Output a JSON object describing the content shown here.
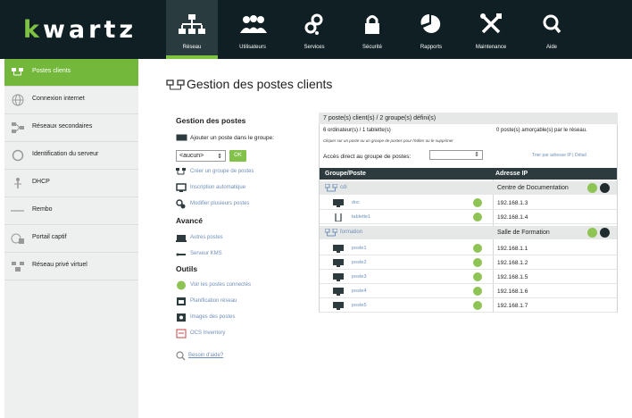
{
  "app": {
    "logo": "kwartz",
    "logo_first": "k",
    "logo_rest": "wartz"
  },
  "nav": [
    {
      "label": "Réseau",
      "icon": "network-icon",
      "active": true
    },
    {
      "label": "Utilisateurs",
      "icon": "users-icon"
    },
    {
      "label": "Services",
      "icon": "gears-icon"
    },
    {
      "label": "Sécurité",
      "icon": "lock-icon"
    },
    {
      "label": "Rapports",
      "icon": "pie-chart-icon"
    },
    {
      "label": "Maintenance",
      "icon": "tools-icon"
    },
    {
      "label": "Aide",
      "icon": "search-icon"
    }
  ],
  "sidebar": {
    "items": [
      {
        "label": "Postes clients",
        "icon": "clients-icon",
        "active": true
      },
      {
        "label": "Connexion internet",
        "icon": "globe-icon"
      },
      {
        "label": "Réseaux secondaires",
        "icon": "subnet-icon"
      },
      {
        "label": "Identification du serveur",
        "icon": "server-id-icon"
      },
      {
        "label": "DHCP",
        "icon": "dhcp-icon"
      },
      {
        "label": "Rembo",
        "icon": "rembo-icon"
      },
      {
        "label": "Portail captif",
        "icon": "portal-icon"
      },
      {
        "label": "Réseau privé virtuel",
        "icon": "vpn-icon"
      }
    ]
  },
  "page": {
    "title": "Gestion des postes clients"
  },
  "left_panel": {
    "heading_gestion": "Gestion des postes",
    "add_label": "Ajouter un poste dans le groupe:",
    "select_value": "<aucun>",
    "ok_label": "OK",
    "gestion_links": [
      "Créer un groupe de postes",
      "Inscription automatique",
      "Modifier plusieurs postes"
    ],
    "heading_avance": "Avancé",
    "avance_links": [
      "Autres postes",
      "Serveur KMS"
    ],
    "heading_outils": "Outils",
    "outils_links": [
      "Voir les postes connectés",
      "Planification réseau",
      "Images des postes",
      "OCS Inventory"
    ],
    "help": "Besoin d'aide?"
  },
  "right_panel": {
    "summary": "7 poste(s) client(s) / 2 groupe(s) défini(s)",
    "info_left": "6 ordinateur(s) / 1 tablette(s)",
    "info_right": "0 poste(s) amorçable(s) par le réseau.",
    "hint": "Cliquer sur un poste ou un groupe de postes pour l'éditer ou le supprimer",
    "direct_label": "Accès direct au groupe de postes:",
    "sort_link": "Trier par adresse IP | Détail",
    "col_group": "Groupe/Poste",
    "col_ip": "Adresse IP",
    "groups": [
      {
        "name": "cdi",
        "location": "Centre de Documentation",
        "hosts": [
          {
            "name": "doc",
            "ip": "192.168.1.3",
            "type": "desktop"
          },
          {
            "name": "tablette1",
            "ip": "192.168.1.4",
            "type": "tablet"
          }
        ]
      },
      {
        "name": "formation",
        "location": "Salle de Formation",
        "hosts": [
          {
            "name": "poste1",
            "ip": "192.168.1.1",
            "type": "desktop"
          },
          {
            "name": "poste2",
            "ip": "192.168.1.2",
            "type": "desktop"
          },
          {
            "name": "poste3",
            "ip": "192.168.1.5",
            "type": "desktop"
          },
          {
            "name": "poste4",
            "ip": "192.168.1.6",
            "type": "desktop"
          },
          {
            "name": "poste5",
            "ip": "192.168.1.7",
            "type": "desktop"
          }
        ]
      }
    ]
  },
  "colors": {
    "accent": "#7ec242",
    "topbar": "#0f1f24",
    "link": "#6f8fb8",
    "table_header": "#2d3b3f"
  }
}
